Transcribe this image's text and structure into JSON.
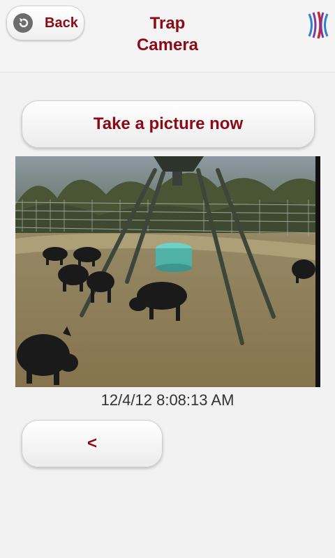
{
  "header": {
    "back_label": "Back",
    "title_line1": "Trap",
    "title_line2": "Camera",
    "accent_color": "#8b0a14"
  },
  "icons": {
    "back": "back-arrow-icon",
    "logo": "brand-logo-icon"
  },
  "actions": {
    "take_picture_label": "Take a picture now",
    "prev_label": "<"
  },
  "photo": {
    "timestamp": "12/4/12 8:08:13 AM"
  }
}
